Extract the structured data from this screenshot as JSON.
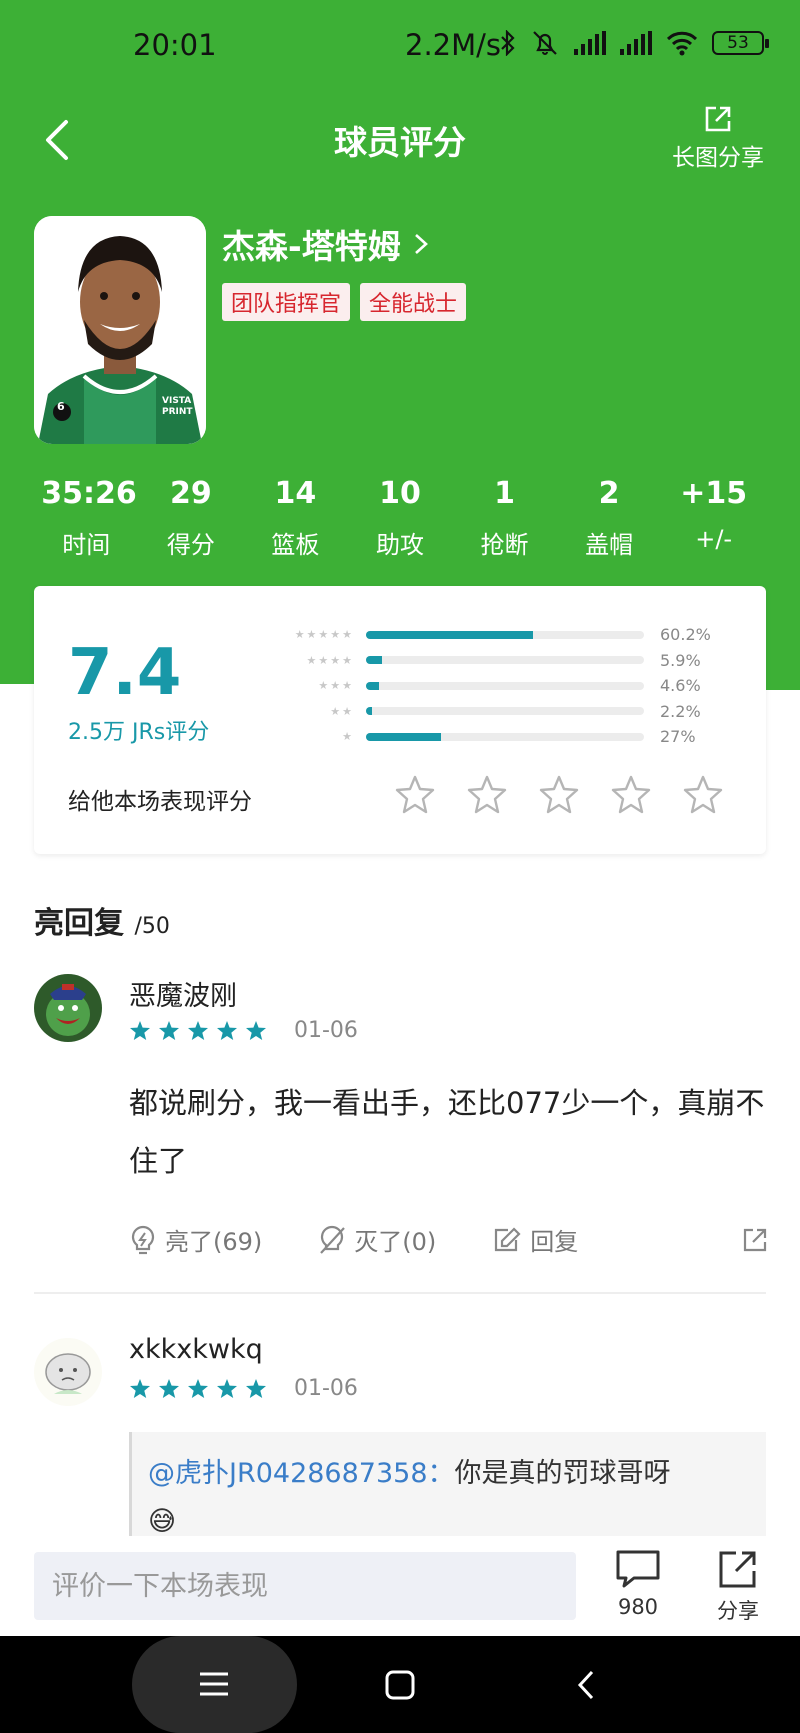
{
  "status_bar": {
    "time": "20:01",
    "network_speed": "2.2M/s",
    "battery": "53"
  },
  "nav": {
    "title": "球员评分",
    "share_label": "长图分享"
  },
  "player": {
    "name": "杰森-塔特姆",
    "tags": [
      "团队指挥官",
      "全能战士"
    ],
    "jersey_number": "6",
    "jersey_text": "VISTA PRINT"
  },
  "stats": [
    {
      "value": "35:26",
      "label": "时间"
    },
    {
      "value": "29",
      "label": "得分"
    },
    {
      "value": "14",
      "label": "篮板"
    },
    {
      "value": "10",
      "label": "助攻"
    },
    {
      "value": "1",
      "label": "抢断"
    },
    {
      "value": "2",
      "label": "盖帽"
    },
    {
      "value": "+15",
      "label": "+/-"
    }
  ],
  "rating": {
    "score": "7.4",
    "count_label": "2.5万 JRs评分",
    "distribution": [
      {
        "stars": 5,
        "percent": 60.2,
        "label": "60.2%"
      },
      {
        "stars": 4,
        "percent": 5.9,
        "label": "5.9%"
      },
      {
        "stars": 3,
        "percent": 4.6,
        "label": "4.6%"
      },
      {
        "stars": 2,
        "percent": 2.2,
        "label": "2.2%"
      },
      {
        "stars": 1,
        "percent": 27,
        "label": "27%"
      }
    ],
    "rate_prompt": "给他本场表现评分",
    "accent_color": "#1898a8"
  },
  "replies_section": {
    "title": "亮回复",
    "count": "/50"
  },
  "replies": [
    {
      "username": "恶魔波刚",
      "stars": 5,
      "date": "01-06",
      "content": "都说刷分，我一看出手，还比077少一个，真崩不住了",
      "like_label": "亮了(69)",
      "dislike_label": "灭了(0)",
      "reply_label": "回复"
    },
    {
      "username": "xkkxkwkq",
      "stars": 5,
      "date": "01-06",
      "quote_user": "@虎扑JR0428687358：",
      "quote_text": "你是真的罚球哥呀",
      "quote_emoji": "😅"
    }
  ],
  "bottom_bar": {
    "placeholder": "评价一下本场表现",
    "comment_count": "980",
    "share_label": "分享"
  },
  "theme": {
    "header_green": "#3db036",
    "tag_red": "#d7262e",
    "star_teal": "#1898a8",
    "link_blue": "#3a7dc8"
  }
}
